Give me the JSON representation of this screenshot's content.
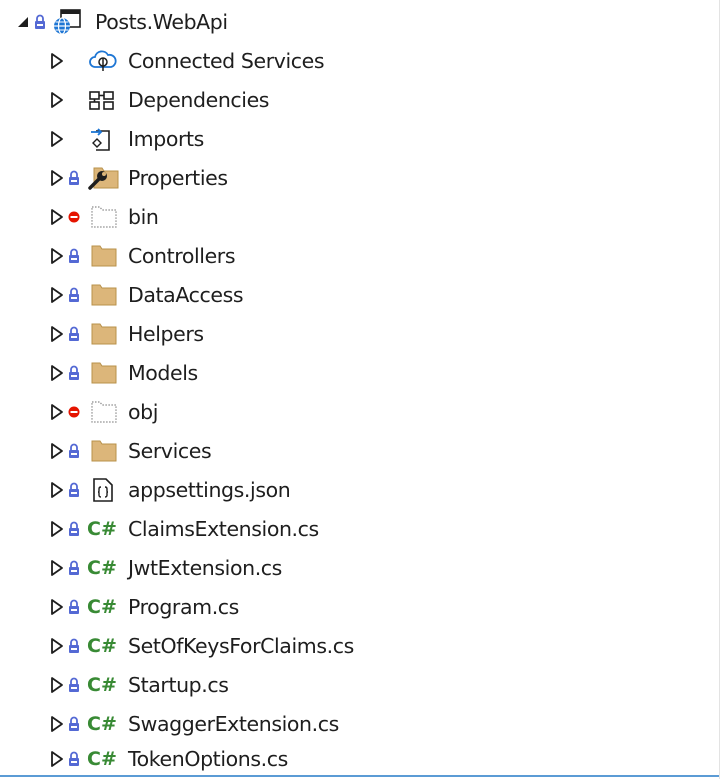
{
  "project": {
    "name": "Posts.WebApi"
  },
  "items": [
    {
      "label": "Connected Services",
      "icon": "connected-services-icon",
      "status": "none"
    },
    {
      "label": "Dependencies",
      "icon": "dependencies-icon",
      "status": "none"
    },
    {
      "label": "Imports",
      "icon": "imports-icon",
      "status": "none"
    },
    {
      "label": "Properties",
      "icon": "properties-folder-icon",
      "status": "locked"
    },
    {
      "label": "bin",
      "icon": "excluded-folder-icon",
      "status": "excluded"
    },
    {
      "label": "Controllers",
      "icon": "folder-icon",
      "status": "locked"
    },
    {
      "label": "DataAccess",
      "icon": "folder-icon",
      "status": "locked"
    },
    {
      "label": "Helpers",
      "icon": "folder-icon",
      "status": "locked"
    },
    {
      "label": "Models",
      "icon": "folder-icon",
      "status": "locked"
    },
    {
      "label": "obj",
      "icon": "excluded-folder-icon",
      "status": "excluded"
    },
    {
      "label": "Services",
      "icon": "folder-icon",
      "status": "locked"
    },
    {
      "label": "appsettings.json",
      "icon": "json-file-icon",
      "status": "locked"
    },
    {
      "label": "ClaimsExtension.cs",
      "icon": "csharp-file-icon",
      "status": "locked"
    },
    {
      "label": "JwtExtension.cs",
      "icon": "csharp-file-icon",
      "status": "locked"
    },
    {
      "label": "Program.cs",
      "icon": "csharp-file-icon",
      "status": "locked"
    },
    {
      "label": "SetOfKeysForClaims.cs",
      "icon": "csharp-file-icon",
      "status": "locked"
    },
    {
      "label": "Startup.cs",
      "icon": "csharp-file-icon",
      "status": "locked"
    },
    {
      "label": "SwaggerExtension.cs",
      "icon": "csharp-file-icon",
      "status": "locked"
    },
    {
      "label": "TokenOptions.cs",
      "icon": "csharp-file-icon",
      "status": "locked"
    }
  ],
  "glyphs": {
    "csharp": "C#"
  },
  "colors": {
    "text": "#1e1e1e",
    "folder": "#dcb67a",
    "lock": "#5469d4",
    "excluded": "#e51400",
    "csharp": "#388a34",
    "globe": "#1e76d4",
    "selection_line": "#5b9bd5"
  }
}
